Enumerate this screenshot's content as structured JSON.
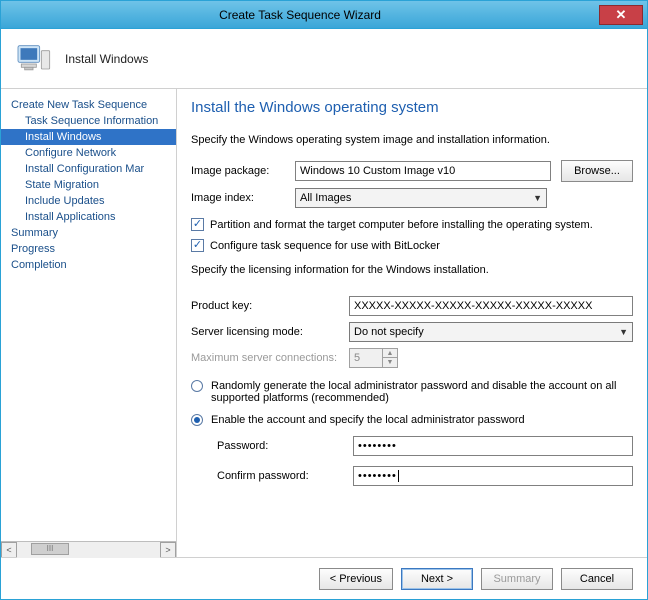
{
  "window": {
    "title": "Create Task Sequence Wizard",
    "close_glyph": "✕"
  },
  "header": {
    "stage": "Install Windows"
  },
  "sidebar": {
    "root": "Create New Task Sequence",
    "items": [
      "Task Sequence Information",
      "Install Windows",
      "Configure Network",
      "Install Configuration Mar",
      "State Migration",
      "Include Updates",
      "Install Applications"
    ],
    "selected_index": 1,
    "tail": [
      "Summary",
      "Progress",
      "Completion"
    ],
    "thumb_label": "III"
  },
  "page": {
    "title": "Install the Windows operating system",
    "desc": "Specify the Windows operating system image and installation information.",
    "image_package_label": "Image package:",
    "image_package_value": "Windows 10 Custom Image v10",
    "browse_label": "Browse...",
    "image_index_label": "Image index:",
    "image_index_value": "All Images",
    "chk_partition": "Partition and format the target computer before installing the operating system.",
    "chk_bitlocker": "Configure task sequence for use with BitLocker",
    "licensing_desc": "Specify the licensing information for the Windows installation.",
    "product_key_label": "Product key:",
    "product_key_value": "XXXXX-XXXXX-XXXXX-XXXXX-XXXXX-XXXXX",
    "server_mode_label": "Server licensing mode:",
    "server_mode_value": "Do not specify",
    "max_conn_label": "Maximum server connections:",
    "max_conn_value": "5",
    "radio_random": "Randomly generate the local administrator password and disable the account on all supported platforms (recommended)",
    "radio_specify": "Enable the account and specify the local administrator password",
    "password_label": "Password:",
    "password_value": "••••••••",
    "confirm_label": "Confirm password:",
    "confirm_value": "••••••••"
  },
  "footer": {
    "previous": "< Previous",
    "next": "Next >",
    "summary": "Summary",
    "cancel": "Cancel"
  }
}
